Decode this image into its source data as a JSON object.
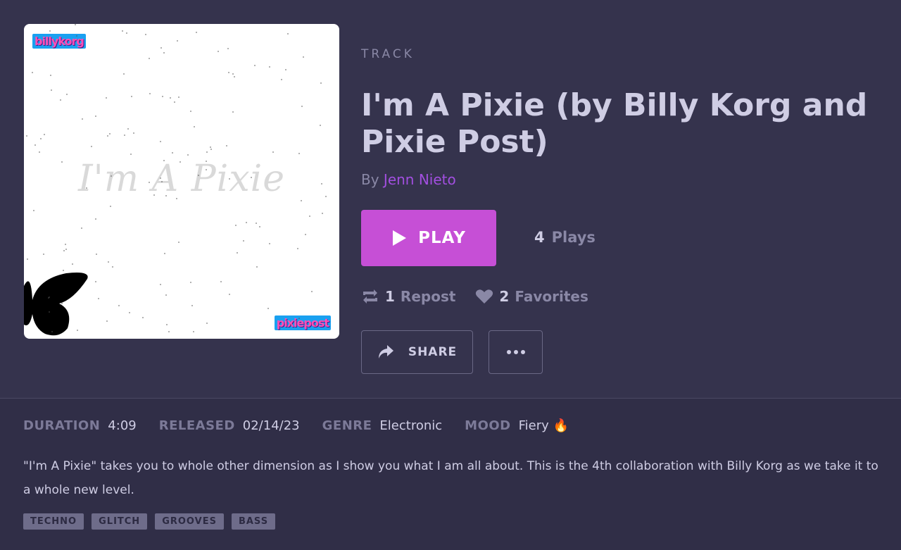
{
  "artwork": {
    "title_text": "I'm A Pixie",
    "logo_top_left": "billykorg",
    "logo_bottom_right": "pixiepost"
  },
  "header": {
    "kind": "TRACK",
    "title": "I'm A Pixie (by Billy Korg and Pixie Post)",
    "by_prefix": "By",
    "artist": "Jenn Nieto"
  },
  "actions": {
    "play_label": "PLAY",
    "plays_count": "4",
    "plays_label": "Plays",
    "repost_count": "1",
    "repost_label": "Repost",
    "favorites_count": "2",
    "favorites_label": "Favorites",
    "share_label": "SHARE"
  },
  "meta": {
    "duration_label": "DURATION",
    "duration": "4:09",
    "released_label": "RELEASED",
    "released": "02/14/23",
    "genre_label": "GENRE",
    "genre": "Electronic",
    "mood_label": "MOOD",
    "mood": "Fiery",
    "mood_emoji": "🔥"
  },
  "description": "\"I'm A Pixie\" takes you to whole other dimension as I show you what I am all about. This is the 4th collaboration with Billy Korg as we take it to a whole new level.",
  "tags": [
    "TECHNO",
    "GLITCH",
    "GROOVES",
    "BASS"
  ],
  "colors": {
    "background": "#35334d",
    "play_button": "#c64fd6",
    "artist_link": "#a24fe0"
  }
}
